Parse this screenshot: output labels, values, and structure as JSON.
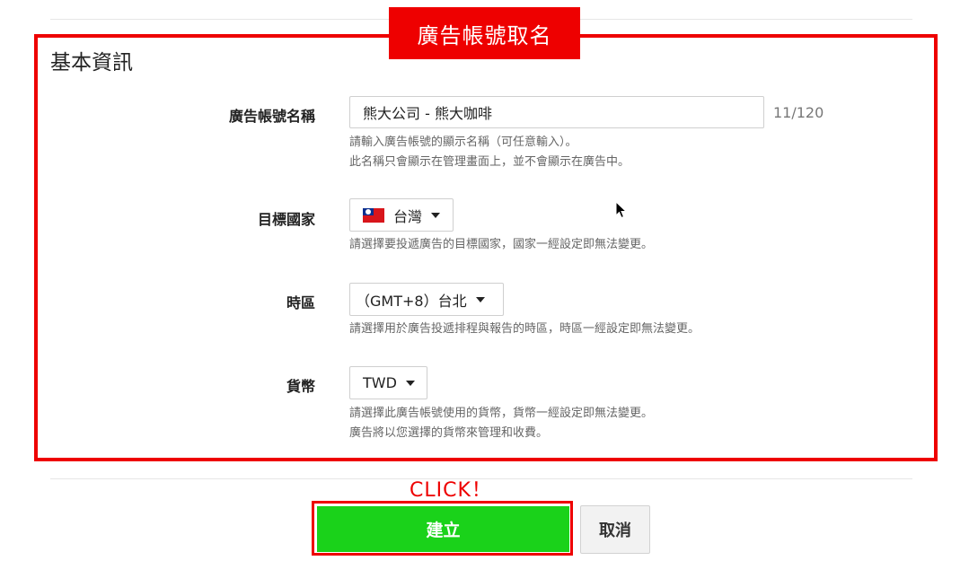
{
  "annotation": {
    "banner": "廣告帳號取名",
    "click_hint": "CLICK！"
  },
  "section": {
    "title": "基本資訊"
  },
  "fields": {
    "account_name": {
      "label": "廣告帳號名稱",
      "value": "熊大公司 - 熊大咖啡",
      "counter": "11/120",
      "help_line1": "請輸入廣告帳號的顯示名稱（可任意輸入）。",
      "help_line2": "此名稱只會顯示在管理畫面上，並不會顯示在廣告中。"
    },
    "country": {
      "label": "目標國家",
      "selected": "台灣",
      "flag_icon": "taiwan-flag-icon",
      "help_line1": "請選擇要投遞廣告的目標國家，國家一經設定即無法變更。"
    },
    "timezone": {
      "label": "時區",
      "selected": "（GMT+8）台北",
      "help_line1": "請選擇用於廣告投遞排程與報告的時區，時區一經設定即無法變更。"
    },
    "currency": {
      "label": "貨幣",
      "selected": "TWD",
      "help_line1": "請選擇此廣告帳號使用的貨幣，貨幣一經設定即無法變更。",
      "help_line2": "廣告將以您選擇的貨幣來管理和收費。"
    }
  },
  "actions": {
    "create_label": "建立",
    "cancel_label": "取消"
  },
  "colors": {
    "annotation_red": "#ee0000",
    "create_green": "#1ad21a"
  }
}
